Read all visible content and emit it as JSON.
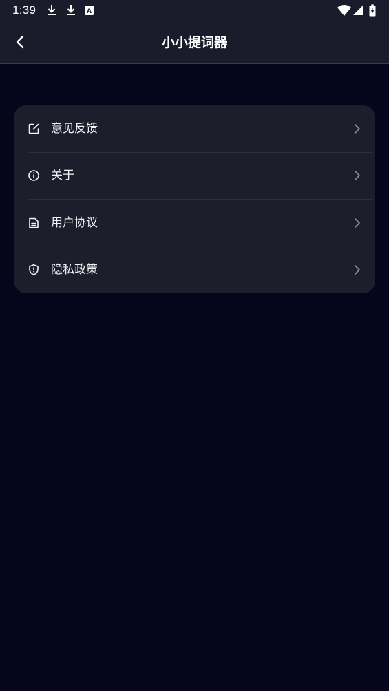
{
  "status_bar": {
    "time": "1:39",
    "icons": [
      "download-icon",
      "download-icon",
      "text-badge-icon",
      "wifi-icon",
      "signal-icon",
      "battery-charging-icon"
    ],
    "badge_letter": "A"
  },
  "header": {
    "title": "小小提词器",
    "back_icon": "chevron-left-icon"
  },
  "menu": {
    "items": [
      {
        "label": "意见反馈",
        "icon": "edit-icon"
      },
      {
        "label": "关于",
        "icon": "info-icon"
      },
      {
        "label": "用户协议",
        "icon": "document-icon"
      },
      {
        "label": "隐私政策",
        "icon": "shield-icon"
      }
    ]
  },
  "colors": {
    "background": "#05061c",
    "header_background": "#1a1c2b",
    "card_background": "#1c1e2c",
    "text": "#ffffff",
    "chevron": "#8a8c9a"
  }
}
